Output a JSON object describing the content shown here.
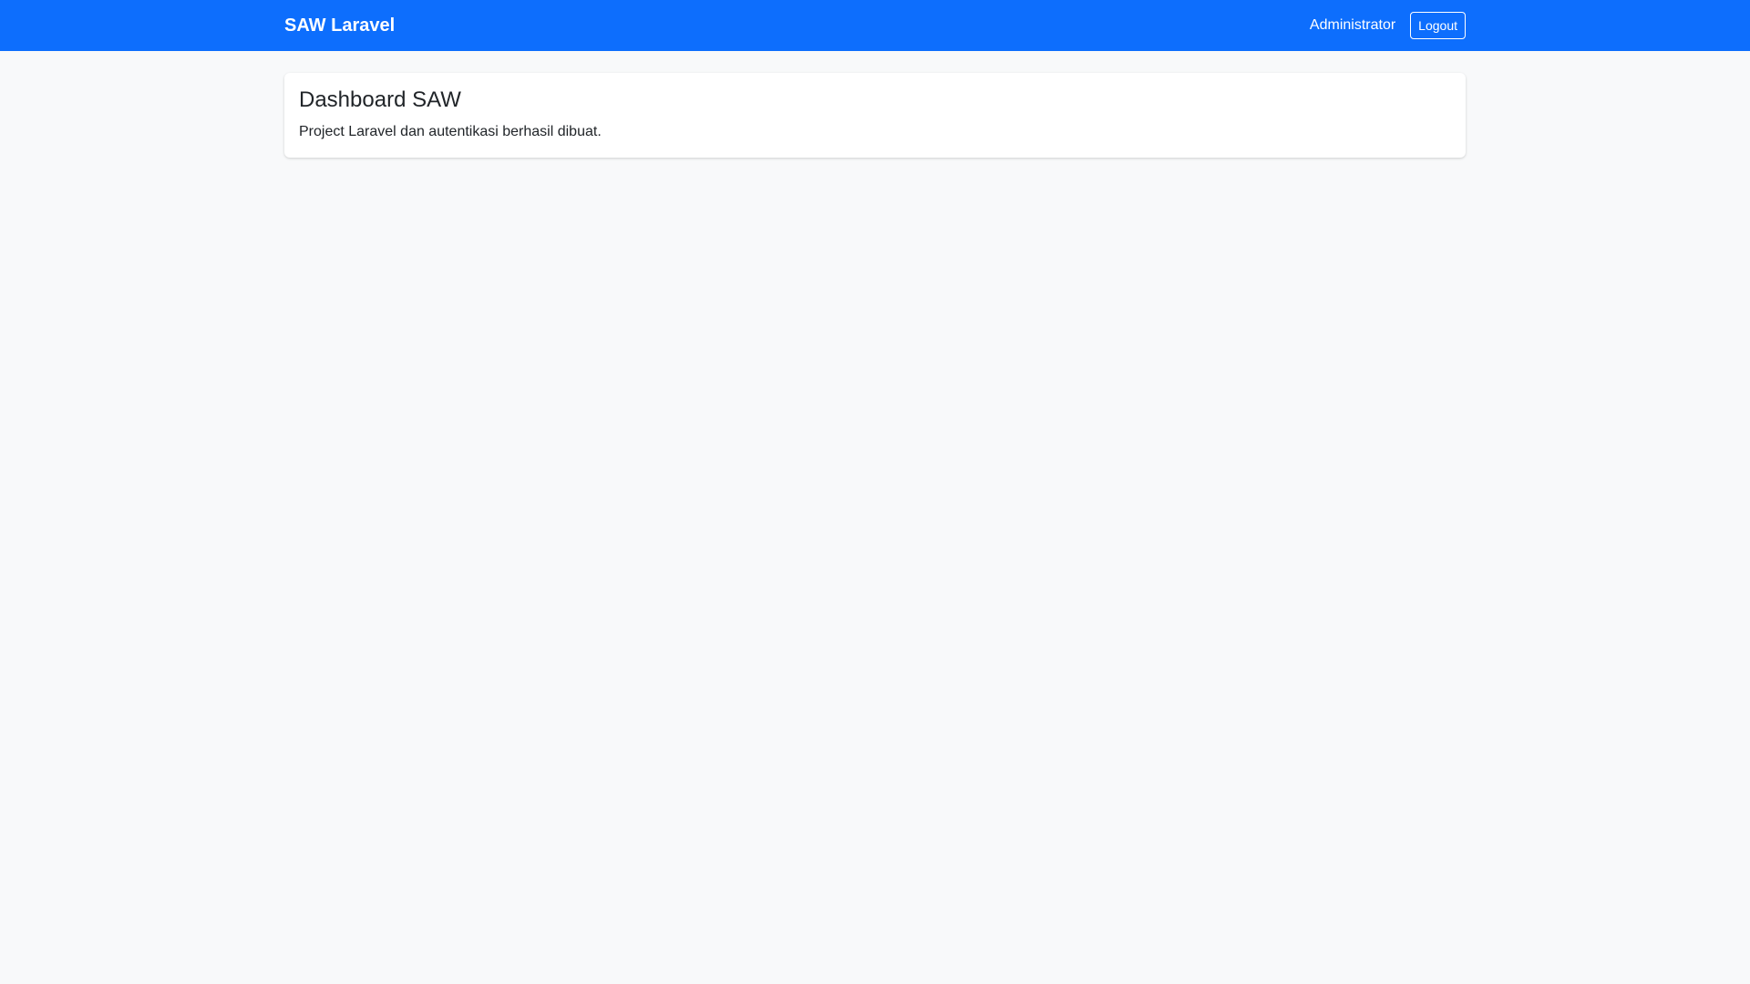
{
  "navbar": {
    "brand": "SAW Laravel",
    "user_name": "Administrator",
    "logout_label": "Logout"
  },
  "main": {
    "card": {
      "title": "Dashboard SAW",
      "text": "Project Laravel dan autentikasi berhasil dibuat."
    }
  },
  "colors": {
    "navbar_bg": "#0d6efd",
    "page_bg": "#f8f9fa",
    "card_bg": "#ffffff"
  }
}
